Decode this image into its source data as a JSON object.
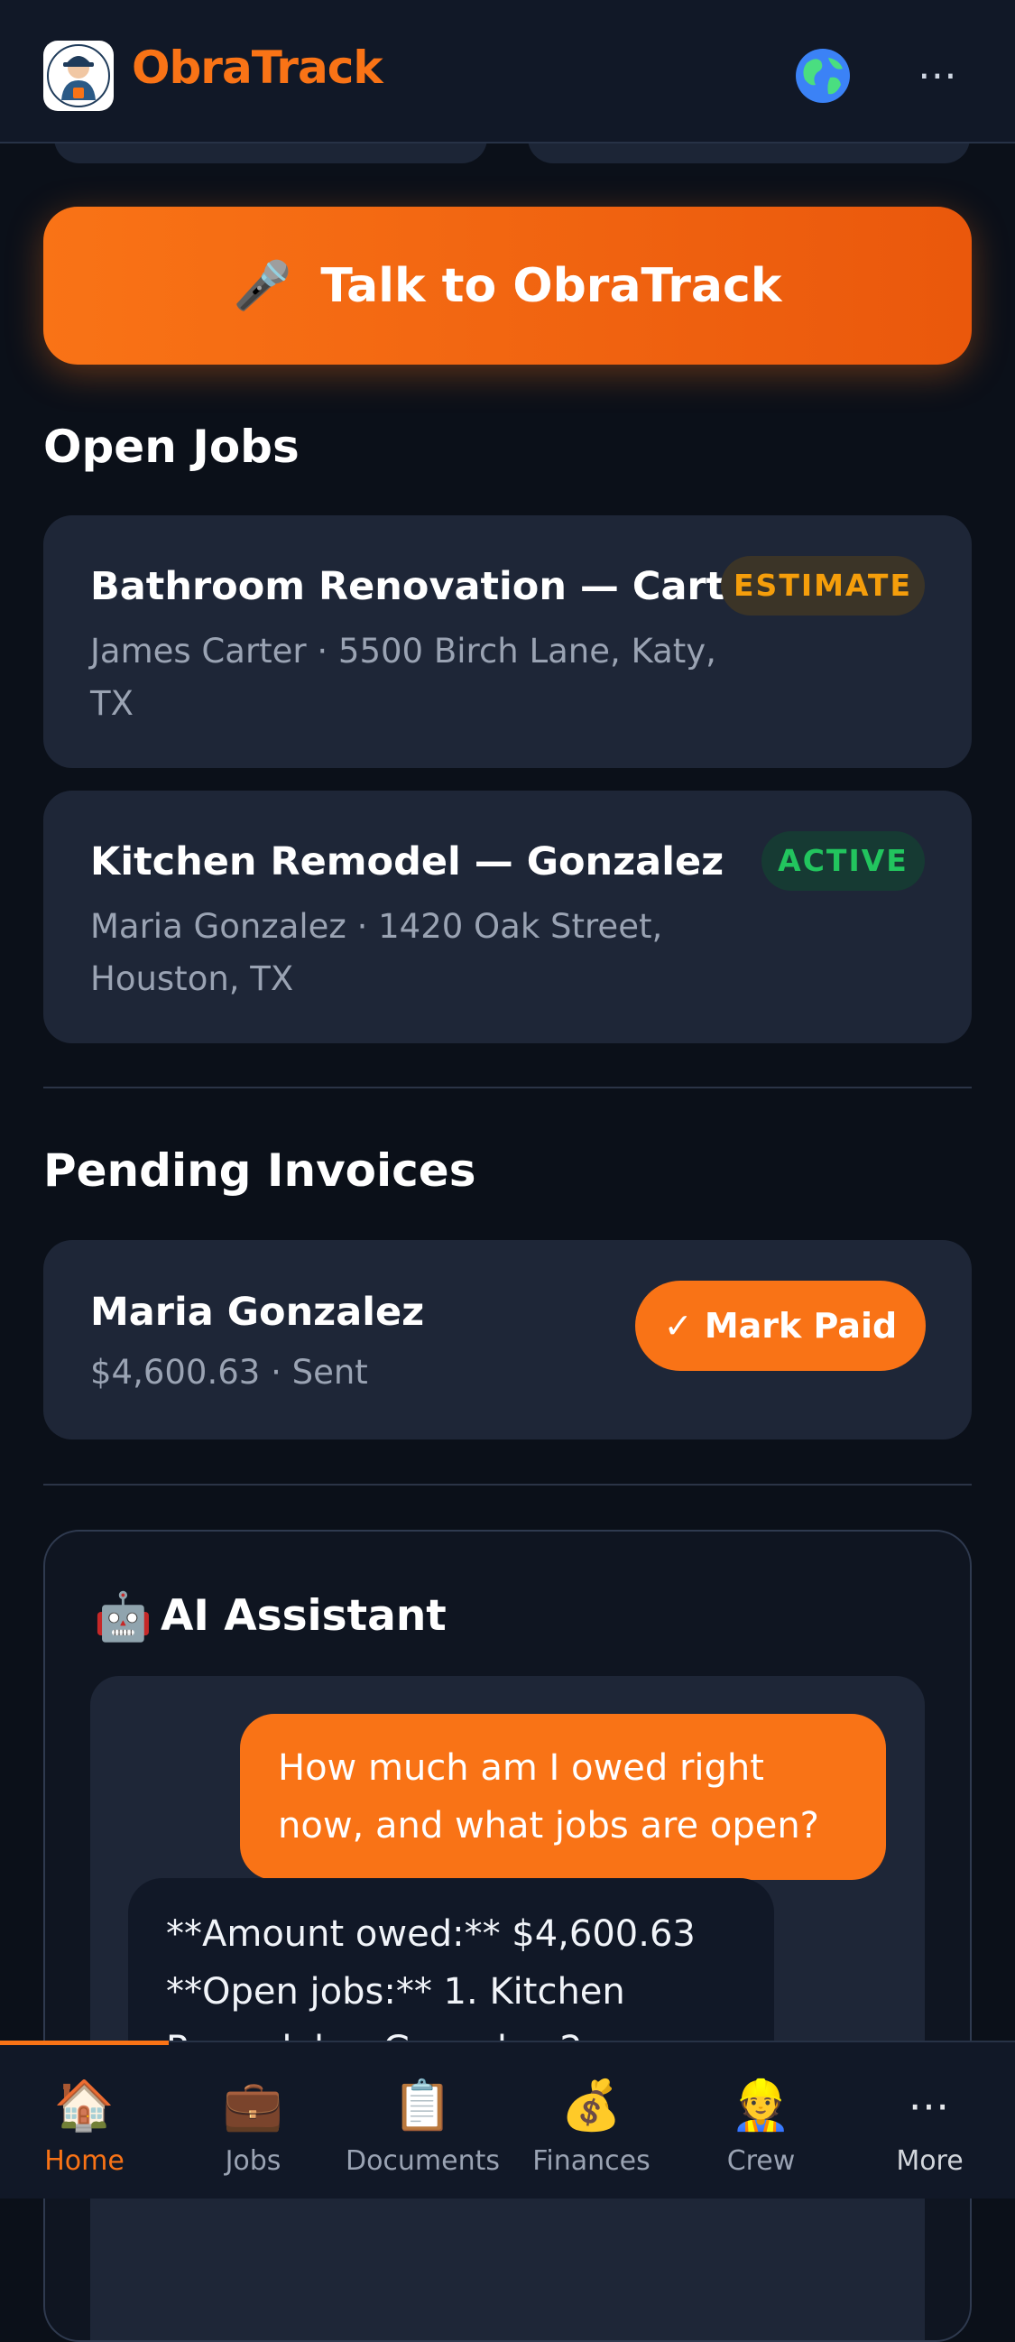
{
  "header": {
    "app_name": "ObraTrack",
    "globe_icon": "🌎",
    "more_icon": "⋯"
  },
  "talk_button": {
    "icon": "🎤",
    "label": "Talk to ObraTrack"
  },
  "open_jobs": {
    "title": "Open Jobs",
    "items": [
      {
        "title": "Bathroom Renovation — Carter",
        "subtitle": "James Carter · 5500 Birch Lane, Katy, TX",
        "status": "ESTIMATE"
      },
      {
        "title": "Kitchen Remodel — Gonzalez",
        "subtitle": "Maria Gonzalez · 1420 Oak Street, Houston, TX",
        "status": "ACTIVE"
      }
    ]
  },
  "pending_invoices": {
    "title": "Pending Invoices",
    "items": [
      {
        "name": "Maria Gonzalez",
        "detail": "$4,600.63 · Sent",
        "action": "✓ Mark Paid"
      }
    ]
  },
  "assistant": {
    "icon": "🤖",
    "title": "AI Assistant",
    "messages": [
      {
        "role": "user",
        "text": "How much am I owed right now, and what jobs are open?"
      },
      {
        "role": "assistant",
        "text": "**Amount owed:** $4,600.63 **Open jobs:** 1. Kitchen Remodel — Gonzalez 2."
      }
    ]
  },
  "bottom_nav": {
    "active": "Home",
    "items": [
      {
        "label": "Home",
        "icon": "🏠"
      },
      {
        "label": "Jobs",
        "icon": "💼"
      },
      {
        "label": "Documents",
        "icon": "📋"
      },
      {
        "label": "Finances",
        "icon": "💰"
      },
      {
        "label": "Crew",
        "icon": "👷"
      },
      {
        "label": "More",
        "icon": "⋯"
      }
    ]
  },
  "colors": {
    "accent": "#f97316",
    "background": "#0b1019",
    "card": "#1e2637",
    "estimate_badge": "#f59e0b",
    "active_badge": "#22c55e"
  }
}
